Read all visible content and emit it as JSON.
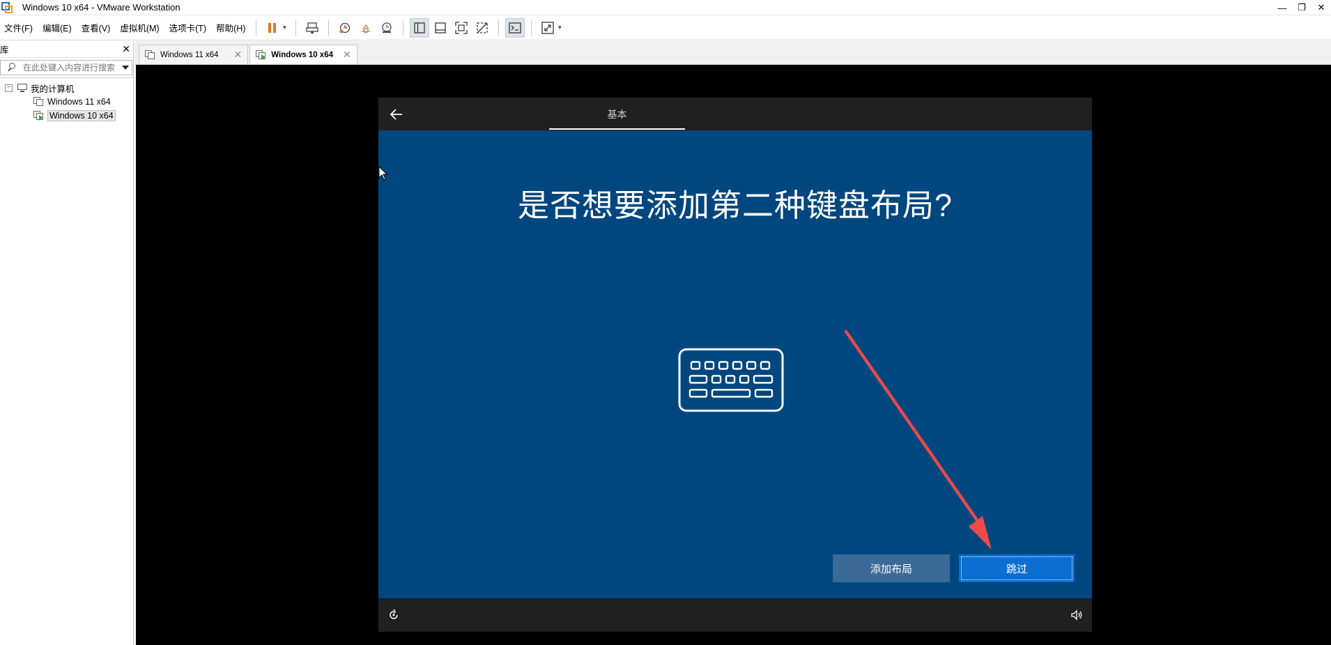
{
  "window": {
    "title": "Windows 10 x64 - VMware Workstation",
    "min_glyph": "—",
    "max_glyph": "❐",
    "close_glyph": "✕"
  },
  "menu": {
    "items": [
      "文件(F)",
      "编辑(E)",
      "查看(V)",
      "虚拟机(M)",
      "选项卡(T)",
      "帮助(H)"
    ]
  },
  "toolbar": {
    "icons": [
      "pause-icon",
      "send-ctrl-alt-del-icon",
      "snapshot-icon",
      "revert-snapshot-icon",
      "snapshot-manager-icon",
      "show-library-icon",
      "thumbnail-bar-icon",
      "full-screen-icon",
      "unity-icon",
      "console-view-icon",
      "stretch-icon"
    ],
    "accent": "#e8731a"
  },
  "library": {
    "title": "库",
    "close_glyph": "✕",
    "search_placeholder": "在此处键入内容进行搜索",
    "tree": {
      "root": "我的计算机",
      "expander": "−",
      "items": [
        "Windows 11 x64",
        "Windows 10 x64"
      ],
      "selected": "Windows 10 x64"
    }
  },
  "tabs": [
    {
      "label": "Windows 11 x64",
      "close": "✕",
      "active": false
    },
    {
      "label": "Windows 10 x64",
      "close": "✕",
      "active": true
    }
  ],
  "oobe": {
    "section": "基本",
    "heading": "是否想要添加第二种键盘布局?",
    "add_button": "添加布局",
    "skip_button": "跳过",
    "background": "#00467f",
    "bar_color": "#202020",
    "primary_button_color": "#0a6fd0",
    "secondary_button_color": "#3b6a96"
  },
  "annotation": {
    "arrow_color": "#f04a4a"
  }
}
